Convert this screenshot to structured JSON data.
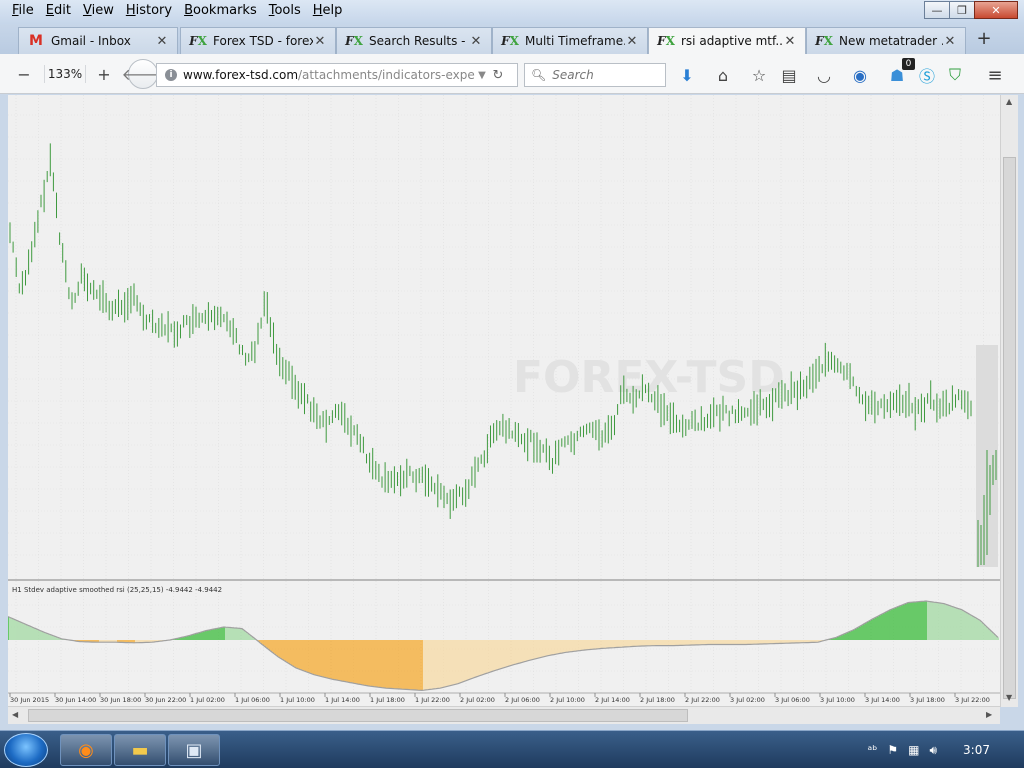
{
  "menu": {
    "items": [
      {
        "label": "File",
        "key": "F",
        "rest": "ile"
      },
      {
        "label": "Edit",
        "key": "E",
        "rest": "dit"
      },
      {
        "label": "View",
        "key": "V",
        "rest": "iew"
      },
      {
        "label": "History",
        "key": "H",
        "rest": "istory"
      },
      {
        "label": "Bookmarks",
        "key": "B",
        "rest": "ookmarks"
      },
      {
        "label": "Tools",
        "key": "T",
        "rest": "ools"
      },
      {
        "label": "Help",
        "key": "H",
        "rest": "elp"
      }
    ]
  },
  "window_buttons": {
    "minimize": "—",
    "maximize": "❐",
    "close": "✕"
  },
  "tabs": [
    {
      "label": "Gmail - Inbox",
      "icon": "gmail",
      "active": false
    },
    {
      "label": "Forex TSD - forex...",
      "icon": "fx",
      "active": false
    },
    {
      "label": "Search Results - ...",
      "icon": "fx",
      "active": false
    },
    {
      "label": "Multi Timeframe...",
      "icon": "fx",
      "active": false
    },
    {
      "label": "rsi adaptive mtf....",
      "icon": "fx",
      "active": true
    },
    {
      "label": "New metatrader ...",
      "icon": "fx",
      "active": false
    }
  ],
  "tab_close": "✕",
  "new_tab": "+",
  "toolbar": {
    "zoom_out": "−",
    "zoom_level": "133%",
    "zoom_in": "+",
    "back": "🡐",
    "url_domain": "www.forex-tsd.com",
    "url_path": "/attachments/indicators-expert-syst",
    "search_placeholder": "Search",
    "notification_count": "0"
  },
  "chart_data": {
    "type": "bar",
    "indicator_label": "H1 Stdev adaptive smoothed rsi (25,25,15) -4.9442 -4.9442",
    "watermark": "FOREX-TSD",
    "x_ticks": [
      "30 Jun 2015",
      "30 Jun 14:00",
      "30 Jun 18:00",
      "30 Jun 22:00",
      "1 Jul 02:00",
      "1 Jul 06:00",
      "1 Jul 10:00",
      "1 Jul 14:00",
      "1 Jul 18:00",
      "1 Jul 22:00",
      "2 Jul 02:00",
      "2 Jul 06:00",
      "2 Jul 10:00",
      "2 Jul 14:00",
      "2 Jul 18:00",
      "2 Jul 22:00",
      "3 Jul 02:00",
      "3 Jul 06:00",
      "3 Jul 10:00",
      "3 Jul 14:00",
      "3 Jul 18:00",
      "3 Jul 22:00"
    ],
    "price_path": [
      0.78,
      0.62,
      0.7,
      0.85,
      0.98,
      0.74,
      0.58,
      0.66,
      0.61,
      0.6,
      0.56,
      0.58,
      0.6,
      0.55,
      0.53,
      0.52,
      0.5,
      0.52,
      0.53,
      0.54,
      0.53,
      0.55,
      0.5,
      0.42,
      0.46,
      0.6,
      0.45,
      0.4,
      0.34,
      0.32,
      0.26,
      0.24,
      0.3,
      0.24,
      0.21,
      0.15,
      0.1,
      0.08,
      0.1,
      0.11,
      0.1,
      0.09,
      0.06,
      0.03,
      0.05,
      0.08,
      0.14,
      0.2,
      0.24,
      0.22,
      0.2,
      0.2,
      0.18,
      0.14,
      0.19,
      0.2,
      0.22,
      0.24,
      0.21,
      0.24,
      0.35,
      0.3,
      0.35,
      0.32,
      0.28,
      0.26,
      0.24,
      0.25,
      0.26,
      0.27,
      0.28,
      0.27,
      0.28,
      0.29,
      0.3,
      0.32,
      0.33,
      0.34,
      0.36,
      0.4,
      0.42,
      0.4,
      0.38,
      0.33,
      0.3,
      0.29,
      0.31,
      0.32,
      0.3,
      0.28,
      0.32,
      0.29,
      0.3,
      0.33,
      0.28,
      -0.18,
      0.0
    ],
    "osc_path": [
      0.45,
      0.3,
      0.15,
      0.02,
      -0.03,
      -0.04,
      -0.04,
      -0.05,
      -0.04,
      0.0,
      0.08,
      0.18,
      0.25,
      0.22,
      -0.05,
      -0.3,
      -0.5,
      -0.62,
      -0.7,
      -0.76,
      -0.82,
      -0.86,
      -0.88,
      -0.9,
      -0.86,
      -0.78,
      -0.66,
      -0.55,
      -0.45,
      -0.36,
      -0.28,
      -0.22,
      -0.18,
      -0.15,
      -0.13,
      -0.11,
      -0.1,
      -0.1,
      -0.09,
      -0.08,
      -0.08,
      -0.08,
      -0.07,
      -0.06,
      -0.05,
      -0.04,
      0.05,
      0.2,
      0.4,
      0.58,
      0.72,
      0.75,
      0.7,
      0.58,
      0.38,
      0.05
    ]
  },
  "taskbar": {
    "apps": [
      "firefox",
      "explorer",
      "window"
    ],
    "clock": "3:07"
  }
}
